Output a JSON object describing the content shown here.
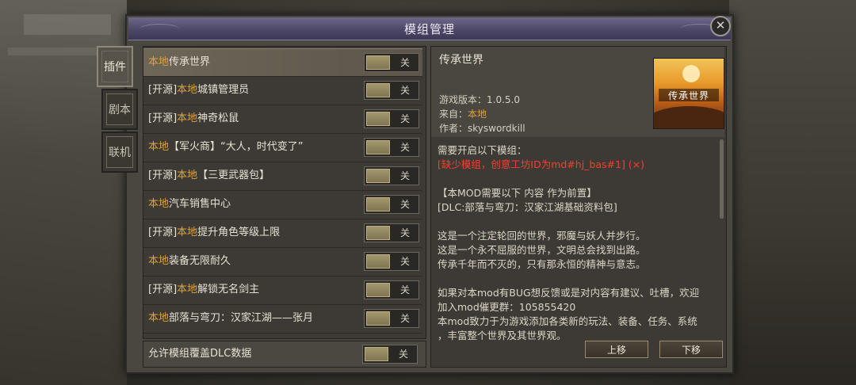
{
  "window": {
    "title": "模组管理"
  },
  "side_tabs": [
    {
      "label": "插件"
    },
    {
      "label": "剧本"
    },
    {
      "label": "联机"
    }
  ],
  "mods": [
    {
      "tag": "",
      "local": "本地",
      "name": "传承世界",
      "state": "关"
    },
    {
      "tag": "[开源]",
      "local": "本地",
      "name": "城镇管理员",
      "state": "关"
    },
    {
      "tag": "[开源]",
      "local": "本地",
      "name": "神奇松鼠",
      "state": "关"
    },
    {
      "tag": "",
      "local": "本地",
      "name": "【军火商】“大人，时代变了”",
      "state": "关"
    },
    {
      "tag": "[开源]",
      "local": "本地",
      "name": "【三更武器包】",
      "state": "关"
    },
    {
      "tag": "",
      "local": "本地",
      "name": "汽车销售中心",
      "state": "关"
    },
    {
      "tag": "[开源]",
      "local": "本地",
      "name": "提升角色等级上限",
      "state": "关"
    },
    {
      "tag": "",
      "local": "本地",
      "name": "装备无限耐久",
      "state": "关"
    },
    {
      "tag": "[开源]",
      "local": "本地",
      "name": "解锁无名剑主",
      "state": "关"
    },
    {
      "tag": "",
      "local": "本地",
      "name": "部落与弯刀：汉家江湖——张月",
      "state": "关"
    }
  ],
  "allow_dlc": {
    "label": "允许模组覆盖DLC数据",
    "state": "关"
  },
  "detail": {
    "name": "传承世界",
    "version": "游戏版本：1.0.5.0",
    "source_prefix": "来自：",
    "source_value": "本地",
    "author": "作者：skyswordkill",
    "thumb_caption": "传承世界",
    "lines": [
      {
        "text": "需要开启以下模组：",
        "style": "normal"
      },
      {
        "text": "[缺少模组，创意工坊ID为md#hj_bas#1] (×)",
        "style": "red"
      },
      {
        "text": "",
        "style": "gap"
      },
      {
        "text": "【本MOD需要以下 内容 作为前置】",
        "style": "normal"
      },
      {
        "text": "[DLC:部落与弯刀：汉家江湖基础资料包]",
        "style": "normal"
      },
      {
        "text": "",
        "style": "gap"
      },
      {
        "text": "这是一个注定轮回的世界，邪魔与妖人并步行。",
        "style": "normal"
      },
      {
        "text": "这是一个永不屈服的世界，文明总会找到出路。",
        "style": "normal"
      },
      {
        "text": "传承千年而不灭的，只有那永恒的精神与意志。",
        "style": "normal"
      },
      {
        "text": "",
        "style": "gap"
      },
      {
        "text": "如果对本mod有BUG想反馈或是对内容有建议、吐槽，欢迎",
        "style": "normal"
      },
      {
        "text": "加入mod催更群：105855420",
        "style": "normal"
      },
      {
        "text": "本mod致力于为游戏添加各类新的玩法、装备、任务、系统",
        "style": "normal"
      },
      {
        "text": "，丰富整个世界及其世界观。",
        "style": "normal"
      }
    ]
  },
  "buttons": {
    "up": "上移",
    "down": "下移"
  },
  "icons": {
    "close": "close-icon"
  }
}
